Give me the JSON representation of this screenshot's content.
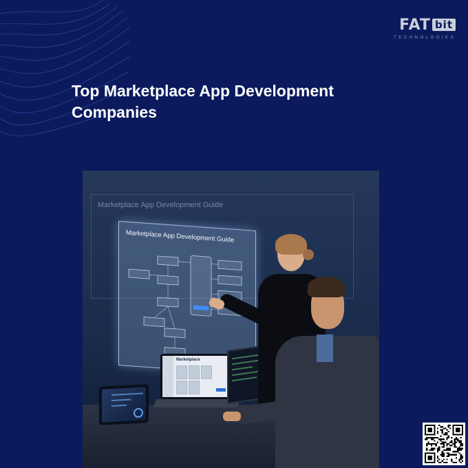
{
  "brand": {
    "logo_text": "FAT",
    "logo_accent": "bit",
    "logo_subtitle": "TECHNOLOGIES"
  },
  "headline": "Top Marketplace App Development Companies",
  "hero_image": {
    "board_title": "Marketplace App Development Guide",
    "panel_title": "Marketplace App Development Guide",
    "laptop_screen_title": "Marketplace"
  },
  "colors": {
    "background": "#0b1a5c",
    "headline": "#ffffff",
    "logo": "#c9ced9",
    "accent_blue": "#2e6fd8"
  },
  "icons": [
    "wave-lines-icon",
    "qr-code-icon"
  ]
}
